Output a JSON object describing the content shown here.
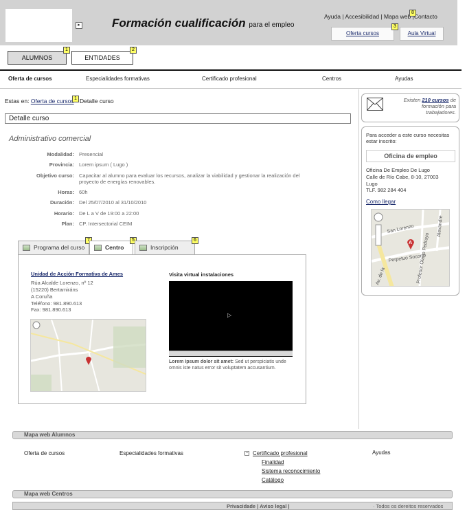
{
  "header": {
    "site_title": "Formación cualificación",
    "site_subtitle": "para el empleo",
    "top_links": {
      "help": "Ayuda",
      "accessibility": "Accesibilidad",
      "sitemap": "Mapa web",
      "contact": "Contacto",
      "sep": "|"
    },
    "oferta_button": "Oferta cursos",
    "aula_button": "Aula Virtual",
    "logo_arrow": "▸"
  },
  "badges": {
    "b1": "1",
    "b2": "2",
    "b3": "3",
    "b4": "4",
    "b5": "5",
    "b6": "6",
    "b7": "7",
    "b8": "8"
  },
  "user_tabs": {
    "alumnos": "ALUMNOS",
    "entidades": "ENTIDADES"
  },
  "nav": {
    "oferta": "Oferta de cursos",
    "especialidades": "Especialidades formativas",
    "certificado": "Certificado profesional",
    "centros": "Centros",
    "ayudas": "Ayudas"
  },
  "breadcrumb": {
    "prefix": "Estas en:",
    "link": "Oferta de cursos",
    "current": "Detalle curso"
  },
  "page_title": "Detalle curso",
  "course": {
    "name": "Administrativo comercial",
    "fields": {
      "modalidad_label": "Modalidad:",
      "modalidad": "Presencial",
      "provincia_label": "Provincia:",
      "provincia": "Lorem ipsum ( Lugo )",
      "objetivo_label": "Objetivo curso:",
      "objetivo": "Capacitar al alumno para evaluar los recursos, analizar la viabilidad y gestionar la realización del proyecto de energías renovables.",
      "horas_label": "Horas:",
      "horas": "60h",
      "duracion_label": "Duración:",
      "duracion": "Del 25/07/2010 al 31/10/2010",
      "horario_label": "Horario:",
      "horario": "De L a V de 19:00 a 22:00",
      "plan_label": "Plan:",
      "plan": "CP. Intersectorial CEIM"
    }
  },
  "detail_tabs": {
    "programa": "Programa del curso",
    "centro": "Centro",
    "inscripcion": "Inscripción"
  },
  "centro": {
    "name": "Unidad de Acción Formativa de Ames",
    "address1": "Rúa Alcalde Lorenzo, nº 12",
    "address2": "(15220) Bertamiráns",
    "address3": "A Coruña",
    "phone": "Teléfono:   981.890.613",
    "fax": "Fax:   981.890.613"
  },
  "video": {
    "title": "Visita virtual instalaciones",
    "caption_bold": "Lorem ipsum dolor sit amet:",
    "caption": "Sed ut perspiciatis unde omnis iste natus error sit voluptatem accusantium.",
    "play": "▷"
  },
  "sidebar": {
    "courses_text_pre": "Existen",
    "courses_count": "210 cursos",
    "courses_text_post": "de formación para trabajadores.",
    "intro": "Para acceder a este curso necesitas estar inscrito:",
    "office_box": "Oficina de empleo",
    "office_name": "Oficina De Empleo De Lugo",
    "office_address": "Calle de Río Cabe, 8-10, 27003",
    "office_city": "Lugo",
    "office_phone": "TLF. 982 284 404",
    "como_llegar": "Como llegar",
    "map_labels": {
      "street1": "San Lorenzo",
      "street2": "Perpetuo Socorro",
      "street3": "Profesor Olano Pedrayo",
      "street4": "Av. de la",
      "street5": "Alexandre",
      "marker": "A"
    }
  },
  "footer": {
    "alumnos_title": "Mapa web Alumnos",
    "centros_title": "Mapa web Centros",
    "col1": "Oferta de cursos",
    "col2": "Especialidades formativas",
    "col3": "Certificado profesional",
    "col3_sub1": "Finalidad",
    "col3_sub2": "Sistema reconocimiento",
    "col3_sub3": "Catálogo",
    "col4": "Ayudas",
    "expand_icon": "−",
    "bottom_links": "Privacidade | Aviso legal |",
    "rights": "· Todos os dereitos reservados"
  }
}
